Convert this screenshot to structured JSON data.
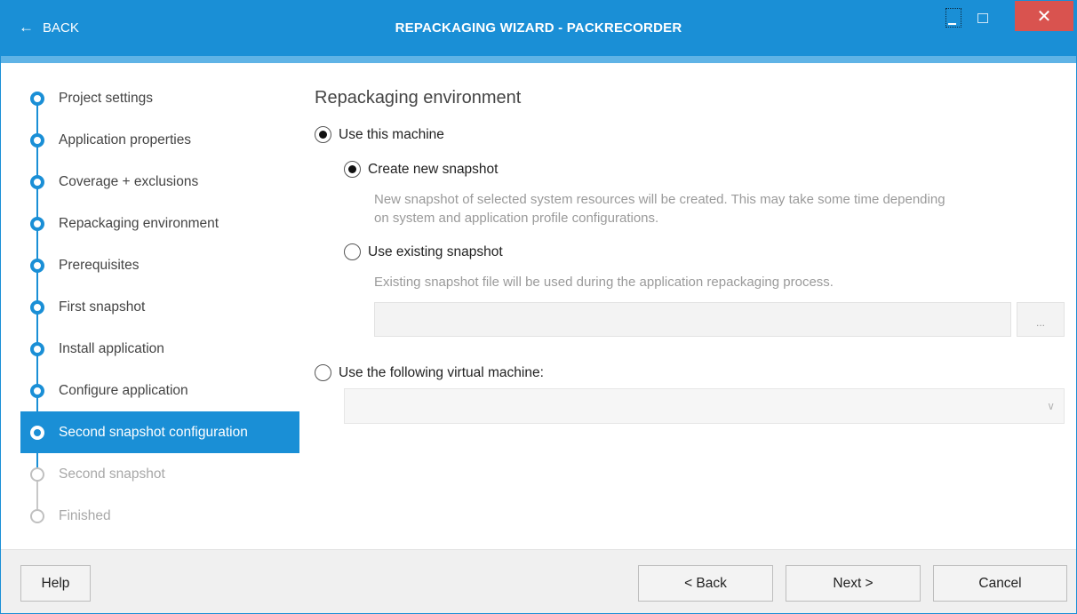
{
  "window": {
    "title": "REPACKAGING WIZARD - PACKRECORDER",
    "back_label": "BACK",
    "accent_color": "#1a8fd6",
    "close_color": "#d9534f"
  },
  "steps": [
    {
      "label": "Project settings",
      "state": "done"
    },
    {
      "label": "Application properties",
      "state": "done"
    },
    {
      "label": "Coverage + exclusions",
      "state": "done"
    },
    {
      "label": "Repackaging environment",
      "state": "done"
    },
    {
      "label": "Prerequisites",
      "state": "done"
    },
    {
      "label": "First snapshot",
      "state": "done"
    },
    {
      "label": "Install application",
      "state": "done"
    },
    {
      "label": "Configure application",
      "state": "done"
    },
    {
      "label": "Second snapshot configuration",
      "state": "active"
    },
    {
      "label": "Second snapshot",
      "state": "pending"
    },
    {
      "label": "Finished",
      "state": "pending"
    }
  ],
  "main": {
    "heading": "Repackaging environment",
    "use_this_machine": {
      "label": "Use this machine",
      "checked": true
    },
    "create_new_snapshot": {
      "label": "Create new snapshot",
      "checked": true,
      "description_line1": "New snapshot of selected system resources will be created. This may take some time depending",
      "description_line2": "on system and application profile configurations."
    },
    "use_existing_snapshot": {
      "label": "Use existing snapshot",
      "checked": false,
      "description": "Existing snapshot file will be used during the application repackaging process.",
      "path_value": "",
      "browse_label": "..."
    },
    "use_virtual_machine": {
      "label": "Use the following virtual machine:",
      "checked": false,
      "selected_vm": ""
    }
  },
  "footer": {
    "help_label": "Help",
    "back_label": "< Back",
    "next_label": "Next >",
    "cancel_label": "Cancel"
  }
}
